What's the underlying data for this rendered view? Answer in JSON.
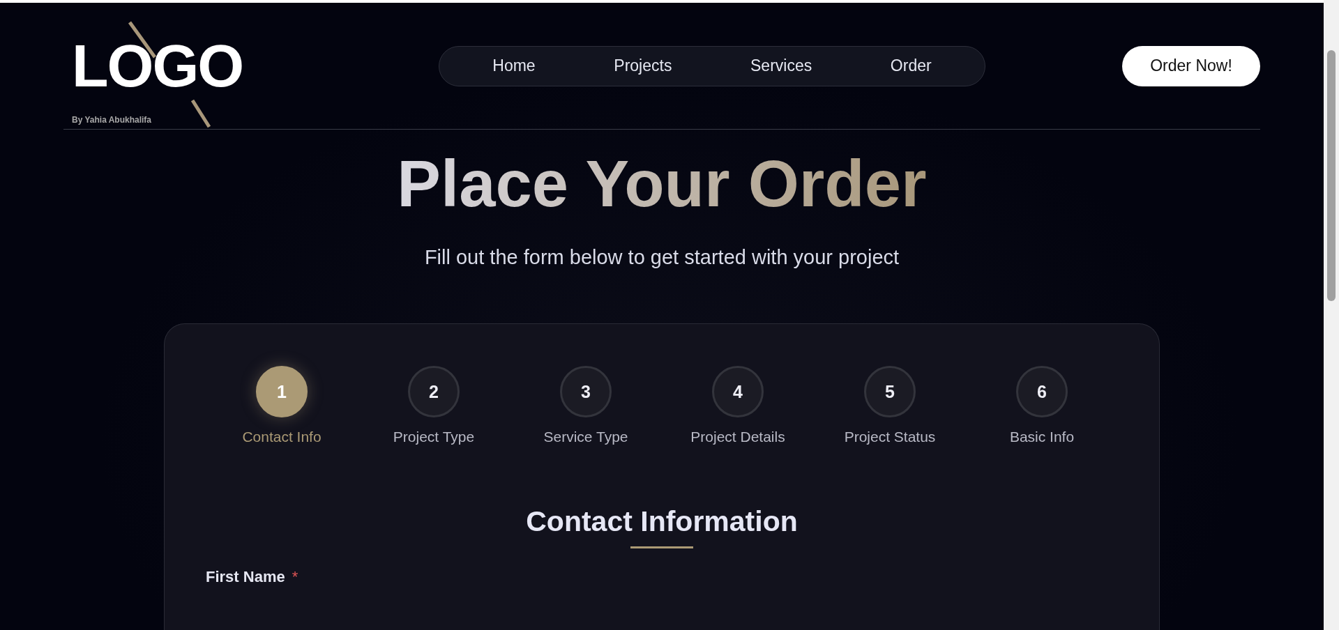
{
  "logo": {
    "text": "LOGO",
    "byline": "By Yahia Abukhalifa"
  },
  "nav": [
    {
      "label": "Home"
    },
    {
      "label": "Projects"
    },
    {
      "label": "Services"
    },
    {
      "label": "Order"
    }
  ],
  "cta": "Order Now!",
  "hero": {
    "title": "Place Your Order",
    "subtitle": "Fill out the form below to get started with your project"
  },
  "steps": [
    {
      "number": "1",
      "label": "Contact Info",
      "selected": true
    },
    {
      "number": "2",
      "label": "Project Type",
      "selected": false
    },
    {
      "number": "3",
      "label": "Service Type",
      "selected": false
    },
    {
      "number": "4",
      "label": "Project Details",
      "selected": false
    },
    {
      "number": "5",
      "label": "Project Status",
      "selected": false
    },
    {
      "number": "6",
      "label": "Basic Info",
      "selected": false
    }
  ],
  "section": {
    "title": "Contact Information"
  },
  "fields": [
    {
      "label": "First Name",
      "required_mark": "*"
    }
  ]
}
